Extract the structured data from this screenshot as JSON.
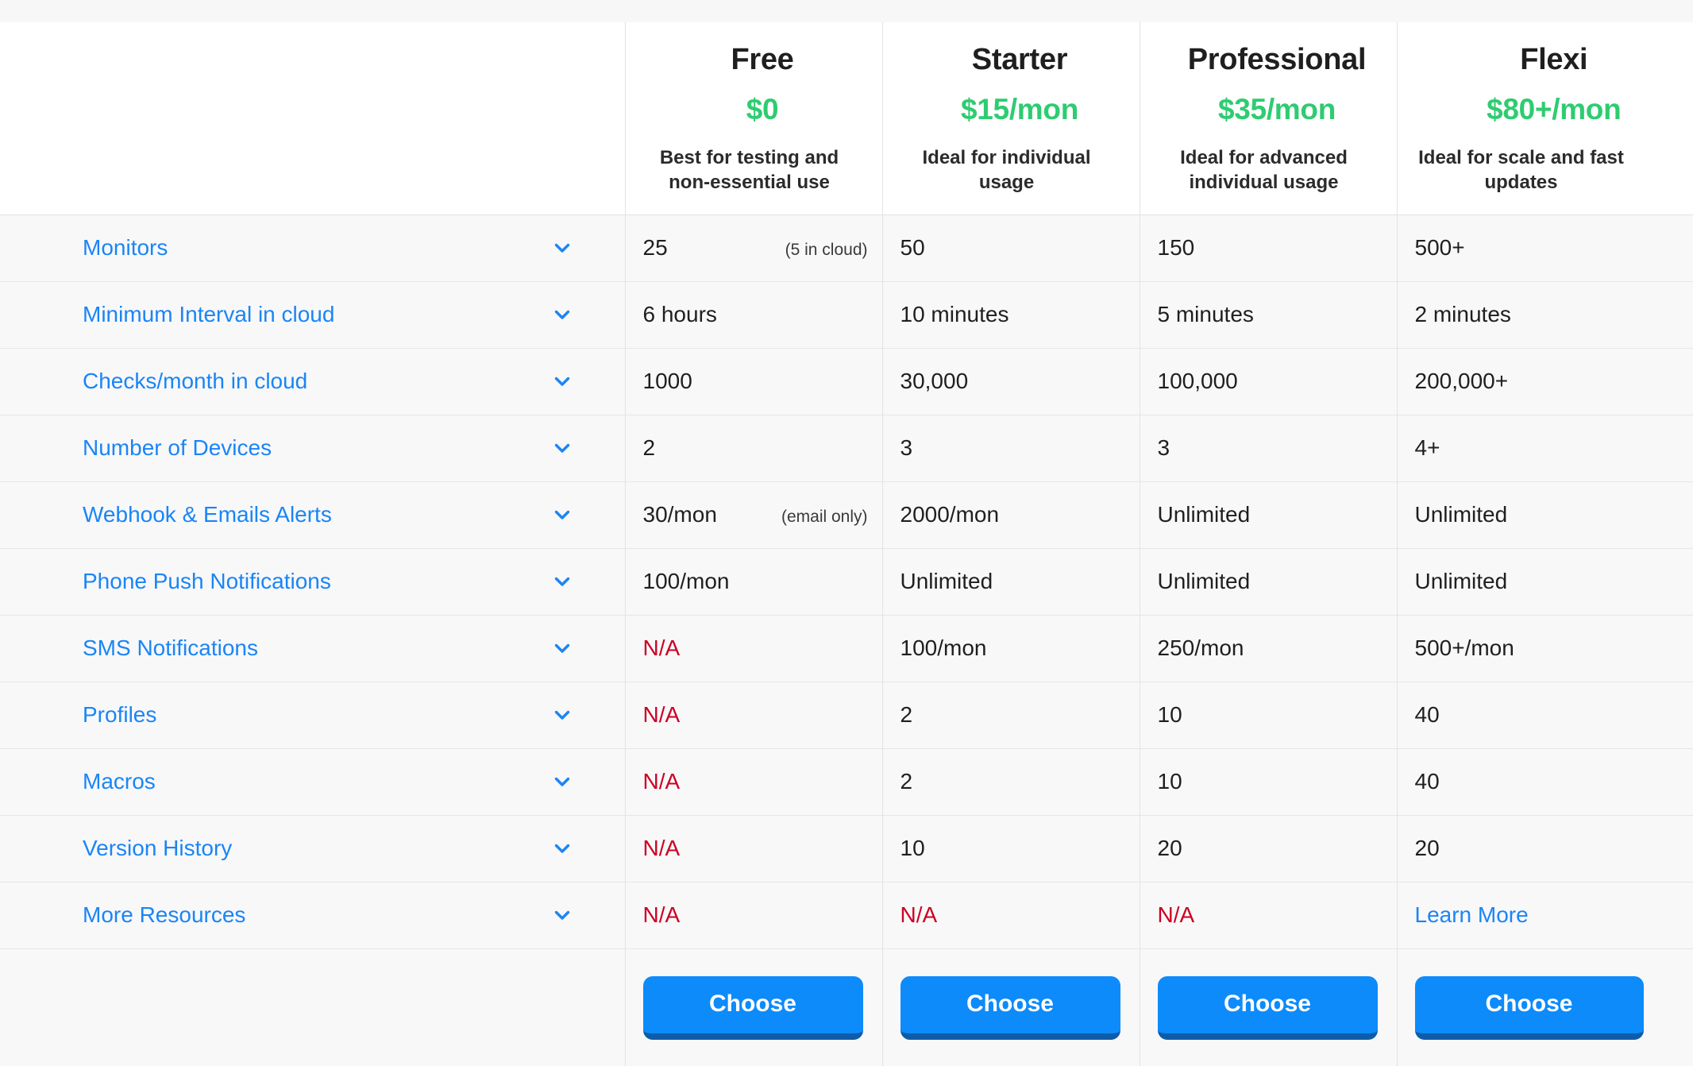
{
  "plans": [
    {
      "name": "Free",
      "price": "$0",
      "description": "Best for testing and non-essential use",
      "cta": "Choose"
    },
    {
      "name": "Starter",
      "price": "$15/mon",
      "description": "Ideal for individual usage",
      "cta": "Choose"
    },
    {
      "name": "Professional",
      "price": "$35/mon",
      "description": "Ideal for advanced individual usage",
      "cta": "Choose"
    },
    {
      "name": "Flexi",
      "price": "$80+/mon",
      "description": "Ideal for scale and fast updates",
      "cta": "Choose"
    }
  ],
  "features": [
    {
      "label": "Monitors",
      "values": [
        {
          "text": "25",
          "note": "(5 in cloud)",
          "style": "normal"
        },
        {
          "text": "50",
          "note": "",
          "style": "normal"
        },
        {
          "text": "150",
          "note": "",
          "style": "normal"
        },
        {
          "text": "500+",
          "note": "",
          "style": "normal"
        }
      ]
    },
    {
      "label": "Minimum Interval in cloud",
      "values": [
        {
          "text": "6 hours",
          "note": "",
          "style": "normal"
        },
        {
          "text": "10 minutes",
          "note": "",
          "style": "normal"
        },
        {
          "text": "5 minutes",
          "note": "",
          "style": "normal"
        },
        {
          "text": "2 minutes",
          "note": "",
          "style": "normal"
        }
      ]
    },
    {
      "label": "Checks/month in cloud",
      "values": [
        {
          "text": "1000",
          "note": "",
          "style": "normal"
        },
        {
          "text": "30,000",
          "note": "",
          "style": "normal"
        },
        {
          "text": "100,000",
          "note": "",
          "style": "normal"
        },
        {
          "text": "200,000+",
          "note": "",
          "style": "normal"
        }
      ]
    },
    {
      "label": "Number of Devices",
      "values": [
        {
          "text": "2",
          "note": "",
          "style": "normal"
        },
        {
          "text": "3",
          "note": "",
          "style": "normal"
        },
        {
          "text": "3",
          "note": "",
          "style": "normal"
        },
        {
          "text": "4+",
          "note": "",
          "style": "normal"
        }
      ]
    },
    {
      "label": "Webhook & Emails Alerts",
      "values": [
        {
          "text": "30/mon",
          "note": "(email only)",
          "style": "normal"
        },
        {
          "text": "2000/mon",
          "note": "",
          "style": "normal"
        },
        {
          "text": "Unlimited",
          "note": "",
          "style": "normal"
        },
        {
          "text": "Unlimited",
          "note": "",
          "style": "normal"
        }
      ]
    },
    {
      "label": "Phone Push Notifications",
      "values": [
        {
          "text": "100/mon",
          "note": "",
          "style": "normal"
        },
        {
          "text": "Unlimited",
          "note": "",
          "style": "normal"
        },
        {
          "text": "Unlimited",
          "note": "",
          "style": "normal"
        },
        {
          "text": "Unlimited",
          "note": "",
          "style": "normal"
        }
      ]
    },
    {
      "label": "SMS Notifications",
      "values": [
        {
          "text": "N/A",
          "note": "",
          "style": "na"
        },
        {
          "text": "100/mon",
          "note": "",
          "style": "normal"
        },
        {
          "text": "250/mon",
          "note": "",
          "style": "normal"
        },
        {
          "text": "500+/mon",
          "note": "",
          "style": "normal"
        }
      ]
    },
    {
      "label": "Profiles",
      "values": [
        {
          "text": "N/A",
          "note": "",
          "style": "na"
        },
        {
          "text": "2",
          "note": "",
          "style": "normal"
        },
        {
          "text": "10",
          "note": "",
          "style": "normal"
        },
        {
          "text": "40",
          "note": "",
          "style": "normal"
        }
      ]
    },
    {
      "label": "Macros",
      "values": [
        {
          "text": "N/A",
          "note": "",
          "style": "na"
        },
        {
          "text": "2",
          "note": "",
          "style": "normal"
        },
        {
          "text": "10",
          "note": "",
          "style": "normal"
        },
        {
          "text": "40",
          "note": "",
          "style": "normal"
        }
      ]
    },
    {
      "label": "Version History",
      "values": [
        {
          "text": "N/A",
          "note": "",
          "style": "na"
        },
        {
          "text": "10",
          "note": "",
          "style": "normal"
        },
        {
          "text": "20",
          "note": "",
          "style": "normal"
        },
        {
          "text": "20",
          "note": "",
          "style": "normal"
        }
      ]
    },
    {
      "label": "More Resources",
      "values": [
        {
          "text": "N/A",
          "note": "",
          "style": "na"
        },
        {
          "text": "N/A",
          "note": "",
          "style": "na"
        },
        {
          "text": "N/A",
          "note": "",
          "style": "na"
        },
        {
          "text": "Learn More",
          "note": "",
          "style": "link"
        }
      ]
    }
  ],
  "icons": {
    "expand": "chevron-down-icon"
  },
  "colors": {
    "price_green": "#2ecc71",
    "link_blue": "#1a85f6",
    "na_red": "#cc0022",
    "button_blue": "#0d8bfb",
    "button_shadow": "#0e5ca8",
    "row_bg": "#f8f8f9",
    "header_bg": "#ffffff",
    "border": "#e3e3e5"
  }
}
